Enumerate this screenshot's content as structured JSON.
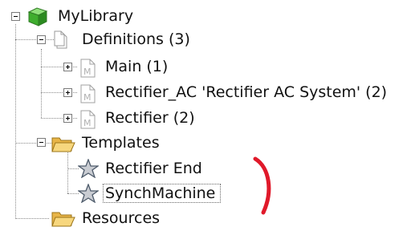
{
  "tree": {
    "root": {
      "label": "MyLibrary",
      "icon": "library-icon"
    },
    "definitions": {
      "label": "Definitions (3)",
      "icon": "document-icon",
      "children": [
        {
          "label": "Main (1)",
          "icon": "model-file-icon"
        },
        {
          "label": "Rectifier_AC 'Rectifier AC System' (2)",
          "icon": "model-file-icon"
        },
        {
          "label": "Rectifier (2)",
          "icon": "model-file-icon"
        }
      ]
    },
    "templates": {
      "label": "Templates",
      "icon": "open-folder-icon",
      "children": [
        {
          "label": "Rectifier End",
          "icon": "star-icon"
        },
        {
          "label": "SynchMachine",
          "icon": "star-icon",
          "selected": true
        }
      ]
    },
    "resources": {
      "label": "Resources",
      "icon": "open-folder-icon"
    }
  },
  "annotation": {
    "color": "#e0192a",
    "shape": "red-bracket-mark"
  }
}
